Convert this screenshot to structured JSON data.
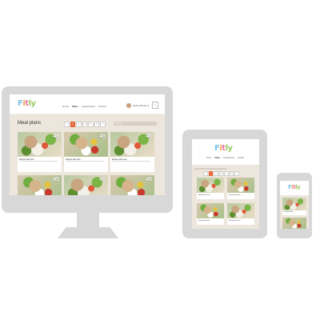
{
  "brand": {
    "logo_letters": [
      "F",
      "i",
      "t",
      "ly"
    ]
  },
  "nav": {
    "items": [
      "Home",
      "Plans",
      "Leaderboard",
      "Contact"
    ],
    "active_index": 1
  },
  "user": {
    "name": "Nancy Brown",
    "chevron": "chevron-down-icon",
    "badge": "1"
  },
  "main": {
    "title": "Meal plans",
    "pagination": [
      "1",
      "2",
      "3",
      "4",
      "5",
      "6",
      "7"
    ],
    "active_page": 1,
    "filter_placeholder": "Search"
  },
  "cards": [
    {
      "title": "Recipe title here",
      "desc": "Lorem ipsum dolor sit amet consectetur adipiscing elit",
      "cal": "45",
      "cal_unit": "min"
    },
    {
      "title": "Recipe title here",
      "desc": "Lorem ipsum dolor sit amet consectetur adipiscing elit",
      "cal": "45",
      "cal_unit": "min"
    },
    {
      "title": "Recipe title here",
      "desc": "Lorem ipsum dolor sit amet consectetur adipiscing elit",
      "cal": "45",
      "cal_unit": "min"
    }
  ],
  "colors": {
    "accent": "#e8663c",
    "device": "#d8d8d8",
    "content_bg": "#ede6dc"
  }
}
